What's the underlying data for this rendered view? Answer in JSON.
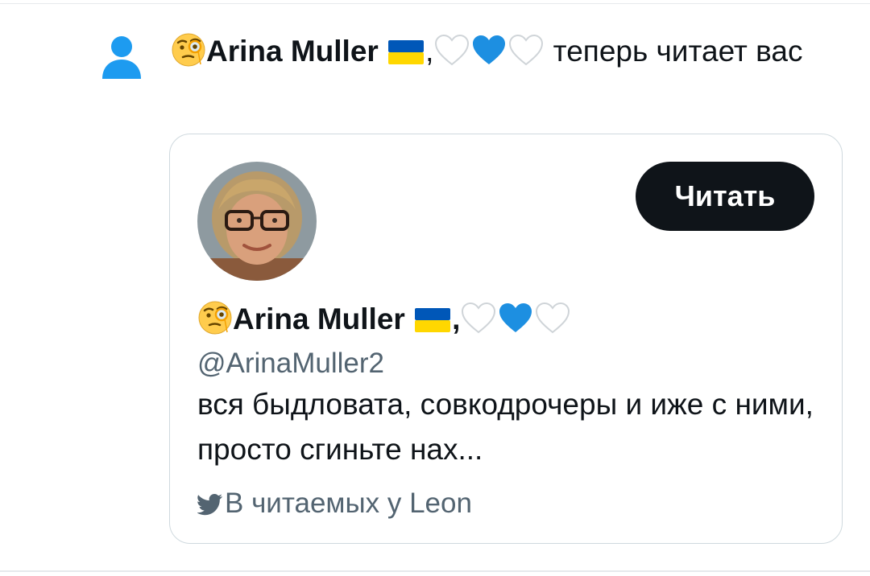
{
  "notification": {
    "icon": "person-icon",
    "actor_name": "Arina Muller",
    "actor_name_suffix": ",",
    "action_text": " теперь читает вас",
    "emojis": [
      "monocle-face-emoji",
      "ukraine-flag-emoji",
      "white-heart-emoji",
      "blue-heart-emoji",
      "white-heart-emoji"
    ]
  },
  "profile_card": {
    "avatar": "woman-with-glasses-avatar",
    "follow_label": "Читать",
    "display_name": "Arina Muller",
    "display_name_suffix": ",",
    "handle": "@ArinaMuller2",
    "bio": "вся быдловата, совкодрочеры и иже с ними, просто сгиньте нах...",
    "context_icon": "bird-icon",
    "context_text": "В читаемых у Leon"
  },
  "colors": {
    "accent_blue": "#1d9bf0",
    "text_primary": "#0f1419",
    "text_secondary": "#536471",
    "border": "#cfd9de",
    "button_bg": "#0f1419"
  }
}
